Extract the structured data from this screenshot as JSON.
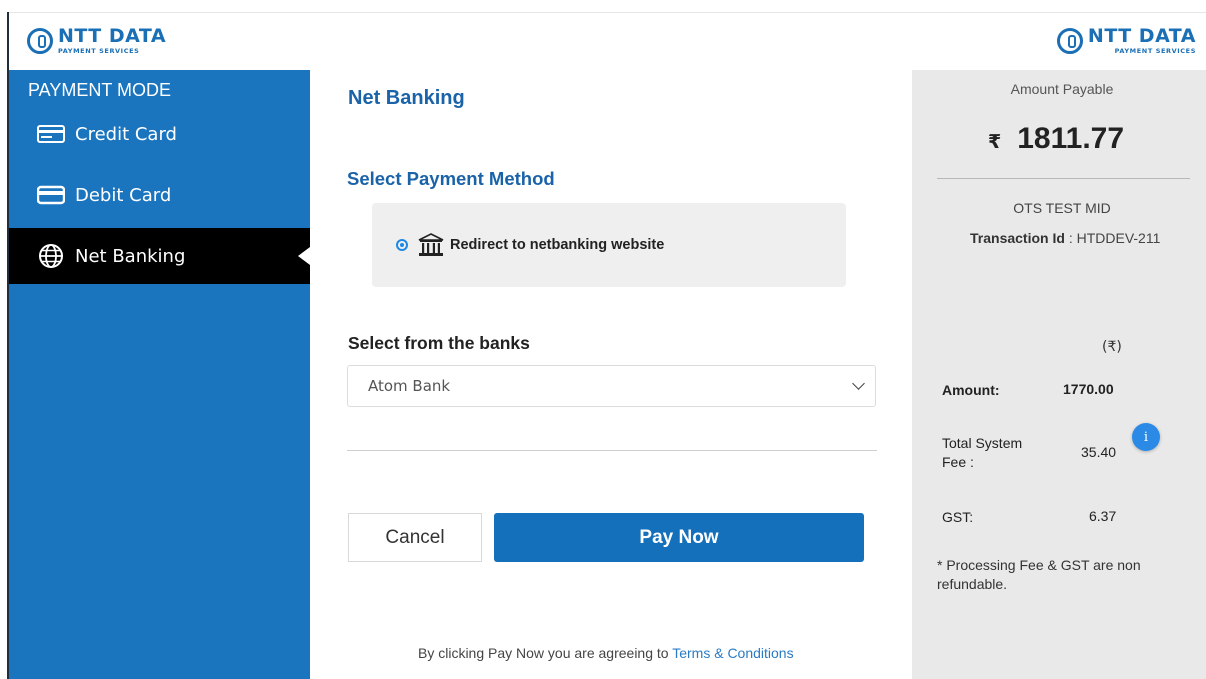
{
  "brand": {
    "name": "NTT DATA",
    "sub": "PAYMENT SERVICES"
  },
  "sidebar": {
    "title": "PAYMENT MODE",
    "items": [
      {
        "label": "Credit Card",
        "icon": "credit-card-icon",
        "active": false
      },
      {
        "label": "Debit Card",
        "icon": "debit-card-icon",
        "active": false
      },
      {
        "label": "Net Banking",
        "icon": "globe-icon",
        "active": true
      }
    ]
  },
  "main": {
    "heading": "Net Banking",
    "method_heading": "Select Payment Method",
    "method_option": "Redirect to netbanking website",
    "banks_label": "Select from the banks",
    "bank_selected": "Atom Bank",
    "cancel_label": "Cancel",
    "pay_label": "Pay Now",
    "agree_text": "By clicking Pay Now you are agreeing to",
    "terms_link": "Terms & Conditions"
  },
  "summary": {
    "amount_payable_label": "Amount Payable",
    "currency_symbol": "₹",
    "amount_payable": "1811.77",
    "merchant": "OTS TEST MID",
    "transaction_label": "Transaction Id",
    "transaction_id": ": HTDDEV-211",
    "currency_header": "(₹)",
    "amount_label": "Amount:",
    "amount_value": "1770.00",
    "fee_label": "Total System Fee :",
    "fee_value": "35.40",
    "gst_label": "GST:",
    "gst_value": "6.37",
    "note": "* Processing Fee & GST are non refundable.",
    "info_glyph": "i"
  },
  "colors": {
    "sidebar_blue": "#1a74be",
    "active_item": "#000000",
    "primary_button": "#1470bb",
    "heading_blue": "#1b63a8",
    "summary_bg": "#e9e9e9"
  }
}
